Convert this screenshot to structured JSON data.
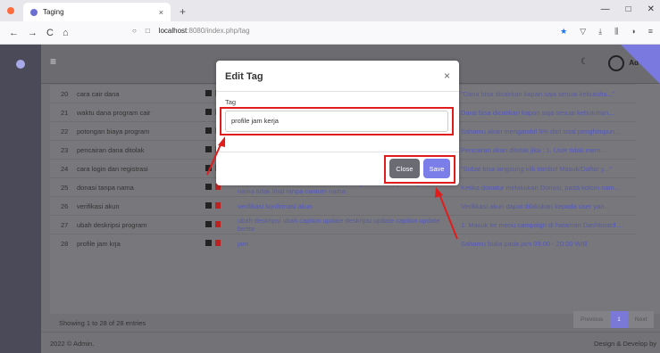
{
  "browser": {
    "tab_title": "Taging",
    "tab_close": "×",
    "new_tab": "+",
    "url_host": "localhost",
    "url_rest": ":8080/index.php/tag",
    "win_min": "—",
    "win_max": "□",
    "win_close": "✕"
  },
  "header": {
    "admin": "Ad"
  },
  "rows": [
    {
      "no": "20",
      "name": "cara cair dana",
      "tags": "",
      "desc": "\"Dana bisa dicairkan kapan saja sesuai kebutuha...\""
    },
    {
      "no": "21",
      "name": "waktu dana program cair",
      "tags": "",
      "desc": "Dana bisa dicairkan kapan saja sesuai kebutuhan..."
    },
    {
      "no": "22",
      "name": "potongan biaya program",
      "tags": "",
      "desc": "Sahamu akan mengambil 5% dari total penghimpun..."
    },
    {
      "no": "23",
      "name": "pencairan dana ditolak",
      "tags": "",
      "desc": "Pencairan akan ditolak jika : 1. User tidak mem..."
    },
    {
      "no": "24",
      "name": "cara login dan registrasi",
      "tags": "",
      "desc": "\"Sobat bisa langsung klik tombol Masuk/Daftar y...\""
    },
    {
      "no": "25",
      "name": "donasi tanpa nama",
      "tags": "tanpa nama  tidak cantum nama  tidak tampil nama  tanpa tampil nama  nama tidak lihat  tanpa cantum nama",
      "desc": "Ketika donatur melakukan Donasi, pada kolom nam..."
    },
    {
      "no": "26",
      "name": "verifikasi akun",
      "tags": "verifikasi  konfirmasi akun",
      "desc": "Verifikasi akun dapat dilakukan kepada user yan..."
    },
    {
      "no": "27",
      "name": "ubah deskripsi program",
      "tags": "ubah deskripsi  ubah caption  update deskripsi  update caption  update berita",
      "desc": "1. Masuk ke menu campaign di halaman Dashboard ..."
    },
    {
      "no": "28",
      "name": "profile jam krja",
      "tags": "jam",
      "desc": "Sahamu buka pada jam 09.00 - 20.00 WIB"
    }
  ],
  "showing": "Showing 1 to 28 of 28 entries",
  "pager": {
    "prev": "Previous",
    "page": "1",
    "next": "Next"
  },
  "footer": {
    "left": "2022 © Admin.",
    "right": "Design & Develop by"
  },
  "modal": {
    "title": "Edit Tag",
    "close_icon": "×",
    "label": "Tag",
    "value": "profile jam kerja",
    "close_label": "Close",
    "save_label": "Save"
  },
  "colors": {
    "accent": "#7b7ee8",
    "annotation": "#e01c1c"
  }
}
